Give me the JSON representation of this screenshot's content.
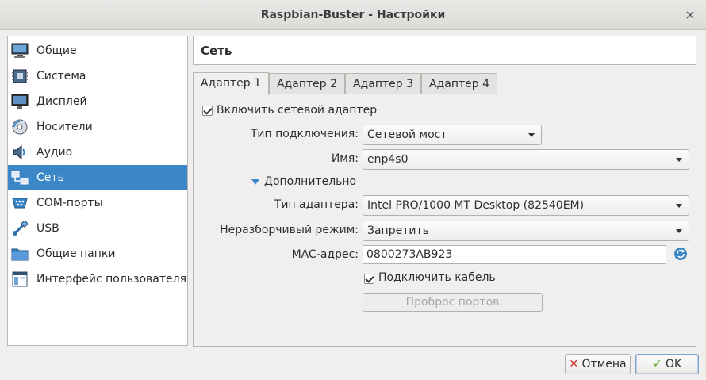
{
  "window": {
    "title": "Raspbian-Buster - Настройки",
    "close_glyph": "×"
  },
  "sidebar": {
    "items": [
      {
        "label": "Общие",
        "icon": "monitor-icon"
      },
      {
        "label": "Система",
        "icon": "chip-icon"
      },
      {
        "label": "Дисплей",
        "icon": "display-icon"
      },
      {
        "label": "Носители",
        "icon": "disk-icon"
      },
      {
        "label": "Аудио",
        "icon": "speaker-icon"
      },
      {
        "label": "Сеть",
        "icon": "network-icon",
        "active": true
      },
      {
        "label": "COM-порты",
        "icon": "serial-port-icon"
      },
      {
        "label": "USB",
        "icon": "usb-icon"
      },
      {
        "label": "Общие папки",
        "icon": "folder-icon"
      },
      {
        "label": "Интерфейс пользователя",
        "icon": "ui-icon"
      }
    ]
  },
  "header": {
    "title": "Сеть"
  },
  "tabs": [
    {
      "label": "Адаптер 1",
      "active": true
    },
    {
      "label": "Адаптер 2"
    },
    {
      "label": "Адаптер 3"
    },
    {
      "label": "Адаптер 4"
    }
  ],
  "adapter": {
    "enable_label": "Включить сетевой адаптер",
    "enable_checked": true,
    "attach_label": "Тип подключения:",
    "attach_value": "Сетевой мост",
    "name_label": "Имя:",
    "name_value": "enp4s0",
    "advanced_label": "Дополнительно",
    "adapter_type_label": "Тип адаптера:",
    "adapter_type_value": "Intel PRO/1000 MT Desktop (82540EM)",
    "promisc_label": "Неразборчивый режим:",
    "promisc_value": "Запретить",
    "mac_label": "MAC-адрес:",
    "mac_value": "0800273AB923",
    "cable_label": "Подключить кабель",
    "cable_checked": true,
    "port_forward_label": "Проброс портов"
  },
  "footer": {
    "cancel_label": "Отмена",
    "ok_label": "OK"
  },
  "colors": {
    "accent": "#3b86c7",
    "ok_check": "#5aa02c",
    "cancel_x": "#c9302c"
  }
}
